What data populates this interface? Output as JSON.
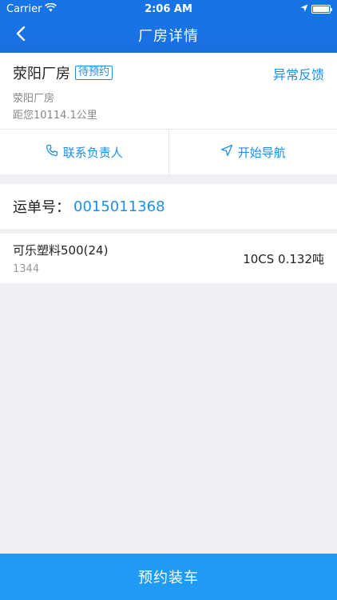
{
  "status_bar": {
    "carrier": "Carrier",
    "time": "2:06 AM"
  },
  "nav": {
    "title": "厂房详情",
    "back_icon": "chevron-left-icon"
  },
  "factory": {
    "name": "荥阳厂房",
    "status_tag": "待预约",
    "feedback_label": "异常反馈",
    "address": "荥阳厂房",
    "distance": "距您10114.1公里"
  },
  "actions": {
    "contact_label": "联系负责人",
    "navigate_label": "开始导航"
  },
  "waybill": {
    "label": "运单号：",
    "number": "0015011368"
  },
  "products": [
    {
      "name": "可乐塑料500(24)",
      "code": "1344",
      "quantity": "10CS 0.132吨"
    }
  ],
  "bottom_button": {
    "label": "预约装车"
  },
  "colors": {
    "nav_bg": "#1774e6",
    "accent": "#1f8ee8",
    "bottom_button": "#1f9bf3",
    "page_bg": "#eeeef3"
  }
}
